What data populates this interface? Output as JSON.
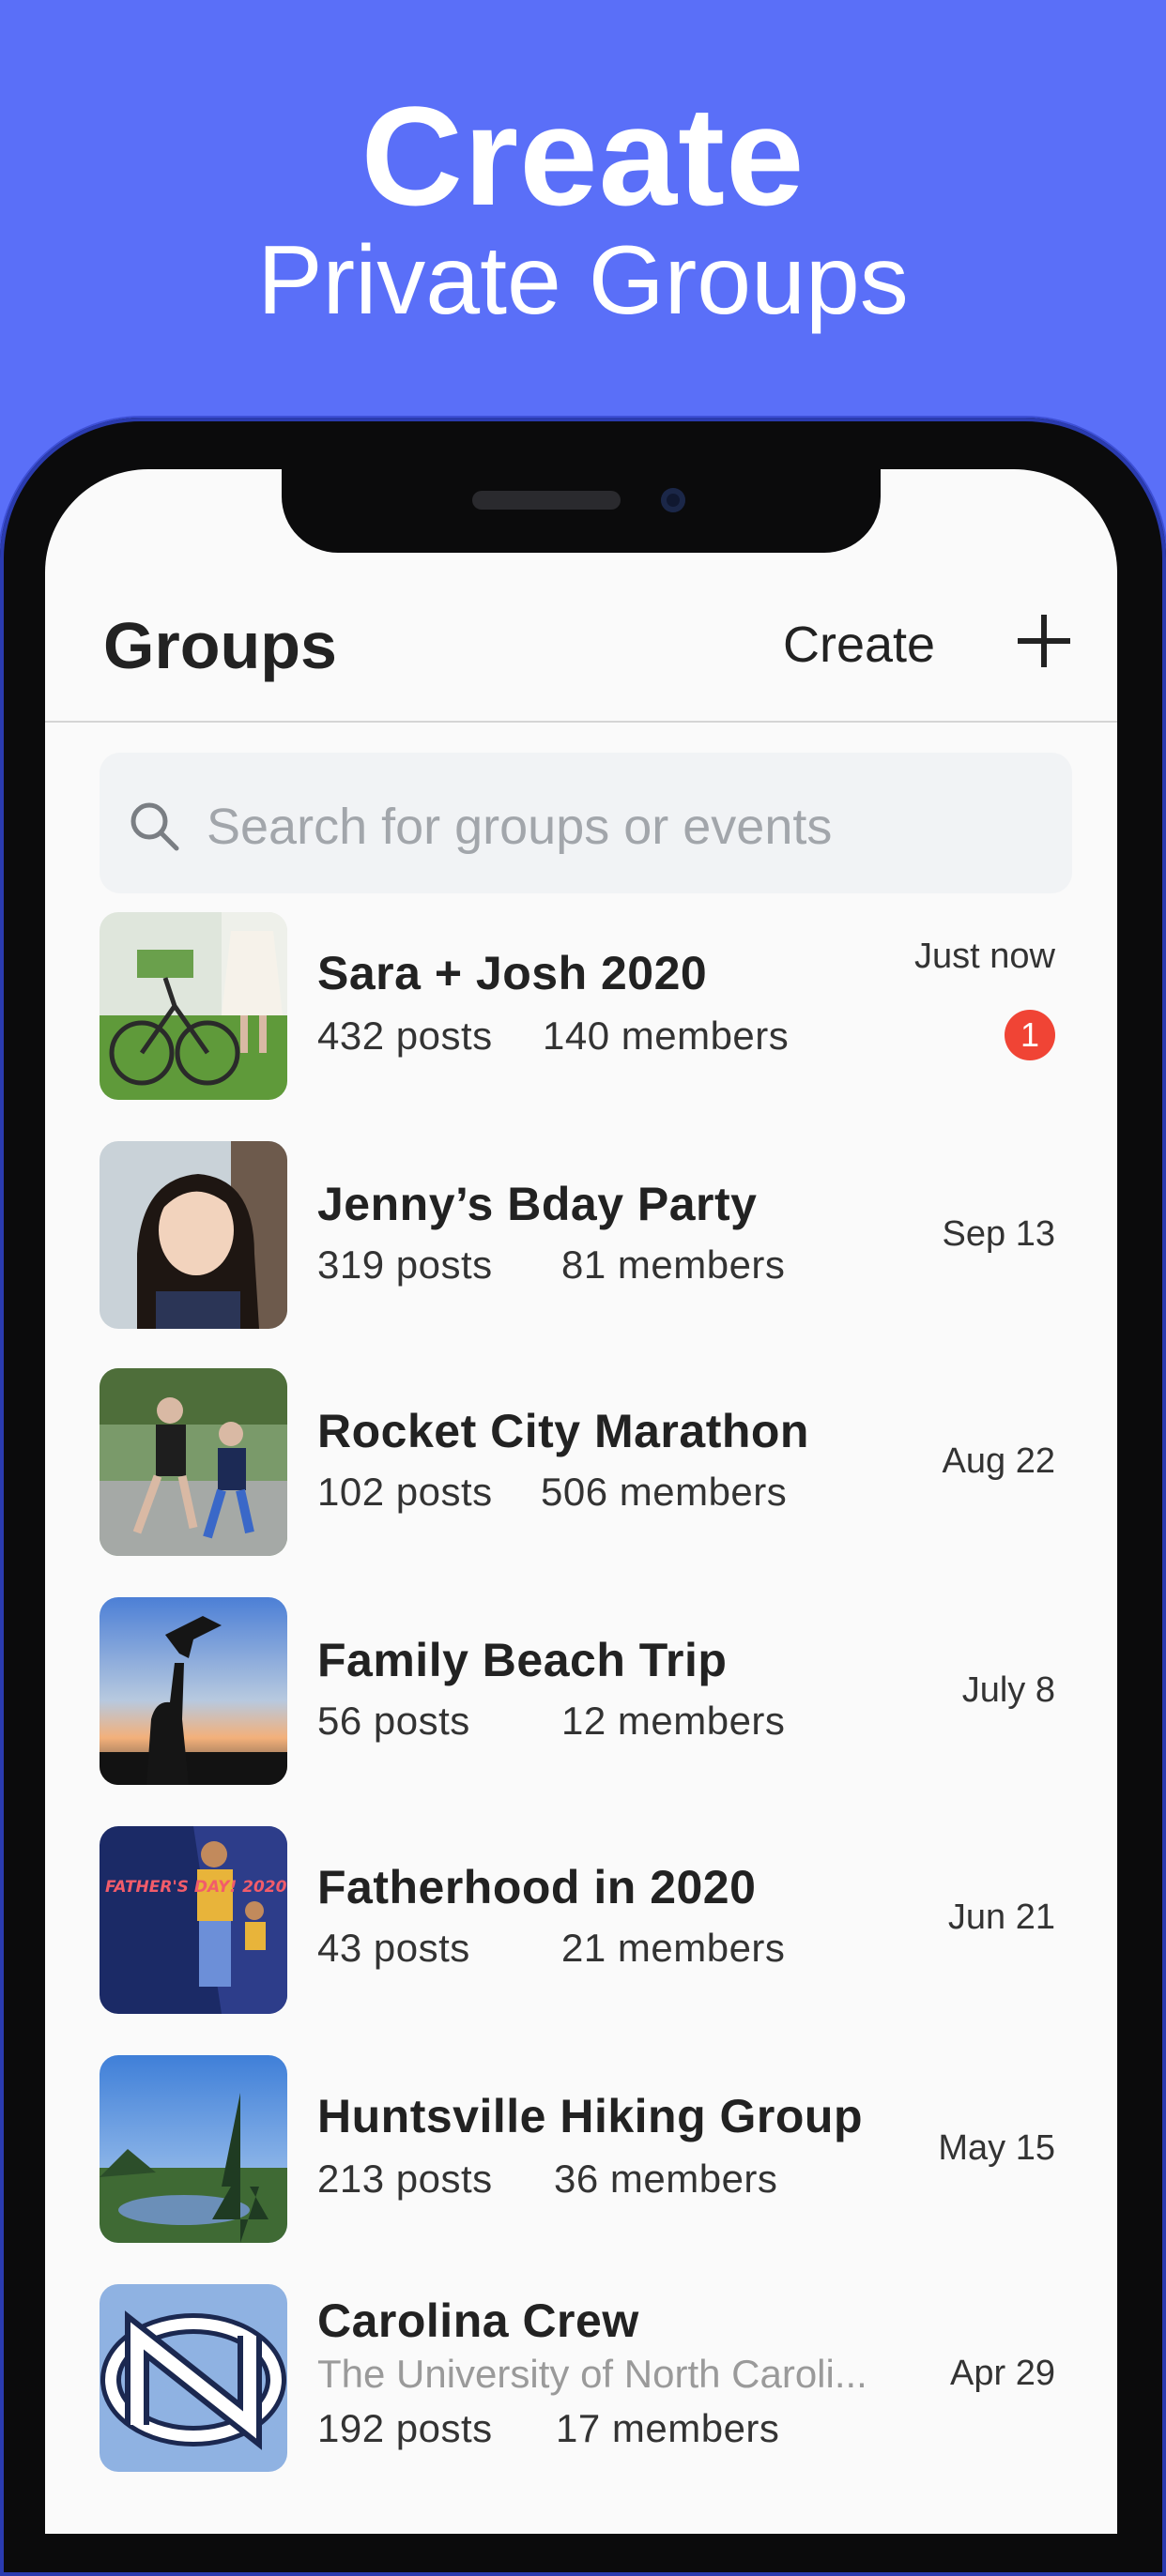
{
  "promo": {
    "line1": "Create",
    "line2": "Private Groups"
  },
  "nav": {
    "title": "Groups",
    "create_label": "Create"
  },
  "search": {
    "placeholder": "Search for groups or events"
  },
  "groups": [
    {
      "title": "Sara + Josh 2020",
      "posts": "432 posts",
      "members": "140 members",
      "date": "Just now",
      "unread": "1",
      "thumb_icon": "bicycle-photo"
    },
    {
      "title": "Jenny’s Bday Party",
      "posts": "319 posts",
      "members": "81 members",
      "date": "Sep 13",
      "thumb_icon": "girl-portrait-photo"
    },
    {
      "title": "Rocket City Marathon",
      "posts": "102 posts",
      "members": "506 members",
      "date": "Aug 22",
      "thumb_icon": "runners-photo"
    },
    {
      "title": "Family Beach Trip",
      "posts": "56 posts",
      "members": "12 members",
      "date": "July 8",
      "thumb_icon": "beach-sunset-photo"
    },
    {
      "title": "Fatherhood in 2020",
      "posts": "43 posts",
      "members": "21 members",
      "date": "Jun 21",
      "thumb_icon": "fathers-day-poster",
      "poster_text": "FATHER'S DAY! 2020"
    },
    {
      "title": "Huntsville Hiking Group",
      "posts": "213 posts",
      "members": "36 members",
      "date": "May 15",
      "thumb_icon": "mountain-lake-photo"
    },
    {
      "title": "Carolina Crew",
      "subtitle": "The University of North Caroli...",
      "posts": "192 posts",
      "members": "17 members",
      "date": "Apr 29",
      "thumb_icon": "nc-logo"
    }
  ],
  "colors": {
    "background": "#5a6ff8",
    "badge": "#f04435",
    "screen": "#fafafa"
  }
}
